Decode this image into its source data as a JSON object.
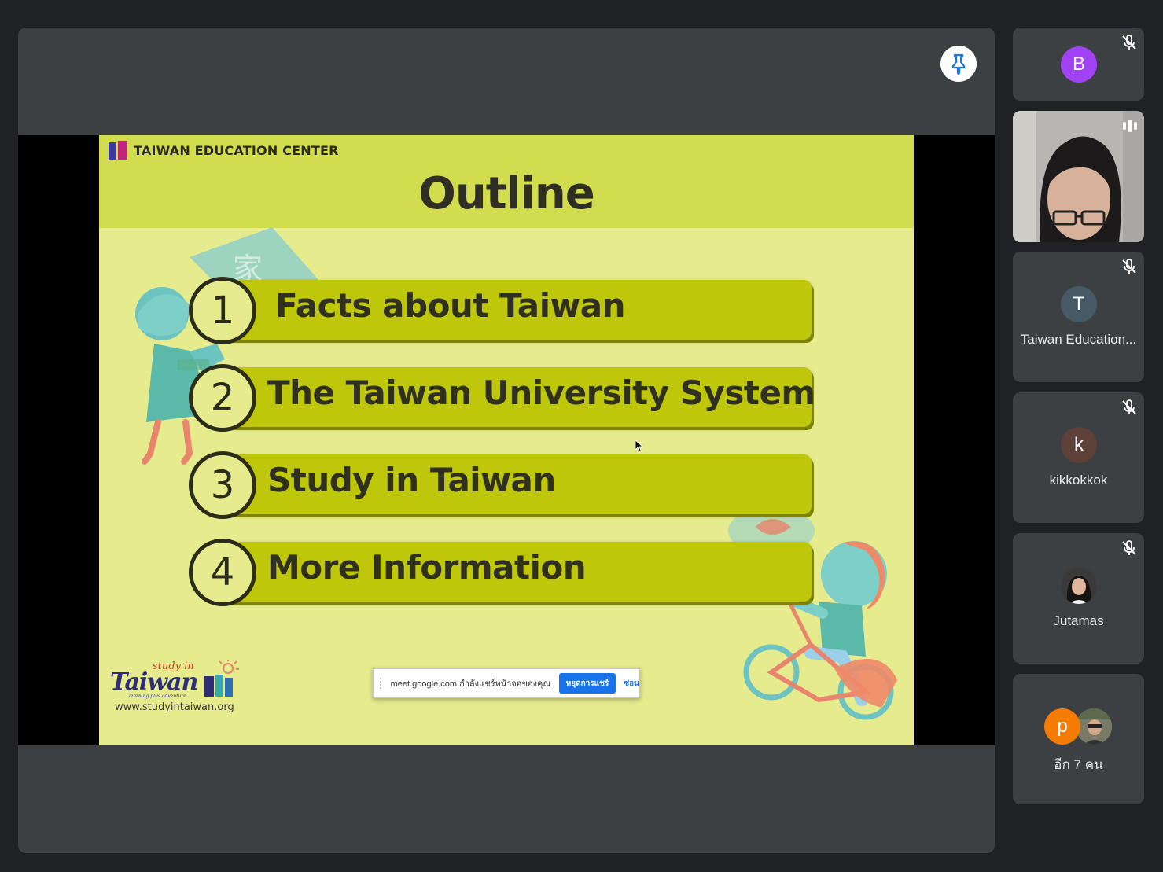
{
  "slide": {
    "brand": "TAIWAN EDUCATION CENTER",
    "title": "Outline",
    "items": [
      {
        "number": "1",
        "label": "Facts about Taiwan"
      },
      {
        "number": "2",
        "label": "The Taiwan University System"
      },
      {
        "number": "3",
        "label": "Study in Taiwan"
      },
      {
        "number": "4",
        "label": "More Information"
      }
    ],
    "logo": {
      "script_small": "study in",
      "script_big": "Taiwan",
      "tagline": "learning plus adventure",
      "url": "www.studyintaiwan.org"
    }
  },
  "share_banner": {
    "text": "meet.google.com กำลังแชร์หน้าจอของคุณ",
    "stop_label": "หยุดการแชร์",
    "hide_label": "ซ่อน"
  },
  "participants": [
    {
      "initial": "B",
      "name": "",
      "avatar_color": "#a142f4",
      "muted": true
    },
    {
      "initial": "",
      "name": "",
      "video": true,
      "speaking": true
    },
    {
      "initial": "T",
      "name": "Taiwan Education...",
      "avatar_color": "#455a64",
      "muted": true
    },
    {
      "initial": "k",
      "name": "kikkokkok",
      "avatar_color": "#5d4037",
      "muted": true
    },
    {
      "initial": "",
      "name": "Jutamas",
      "photo": true,
      "muted": true
    },
    {
      "initial": "p",
      "name": "อีก 7 คน",
      "avatar_color": "#f57c00",
      "more": true
    }
  ],
  "colors": {
    "background": "#202124",
    "tile": "#3c4043",
    "slide_bg": "#e6ec8e",
    "slide_header": "#d2dc4f",
    "bar": "#bfc70b",
    "accent_blue": "#1a73e8"
  }
}
